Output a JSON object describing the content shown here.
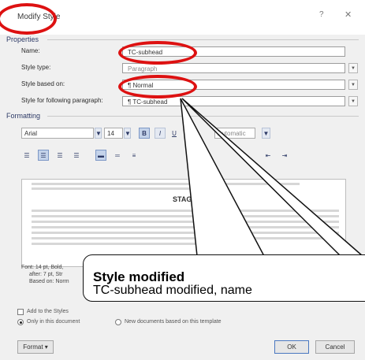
{
  "dialog": {
    "title": "Modify Style",
    "help_glyph": "?",
    "close_glyph": "✕"
  },
  "properties": {
    "section_label": "Properties",
    "name_label": "Name:",
    "name_value": "TC-subhead",
    "style_type_label": "Style type:",
    "style_type_value": "Paragraph",
    "style_based_on_label": "Style based on:",
    "style_based_on_value": "¶ Normal",
    "following_label": "Style for following paragraph:",
    "following_value": "¶ TC-subhead"
  },
  "formatting": {
    "section_label": "Formatting",
    "font_value": "Arial",
    "size_value": "14",
    "bold_label": "B",
    "italic_label": "I",
    "underline_label": "U",
    "color_value": "Automatic",
    "sample_text": "STAGE"
  },
  "description": {
    "line1": "Font: 14 pt, Bold,",
    "line2": "after: 7 pt, Str",
    "line3": "Based on: Norm"
  },
  "options": {
    "add_to_gallery": "Add to the Styles",
    "only_this_document": "Only in this document",
    "new_documents": "New documents based on this template"
  },
  "buttons": {
    "format": "Format ▾",
    "ok": "OK",
    "cancel": "Cancel"
  },
  "callout": {
    "title": "Style modified",
    "body": "TC-subhead modified, name"
  },
  "colors": {
    "annotation_red": "#dd1111",
    "accent_blue": "#2d3a66"
  }
}
